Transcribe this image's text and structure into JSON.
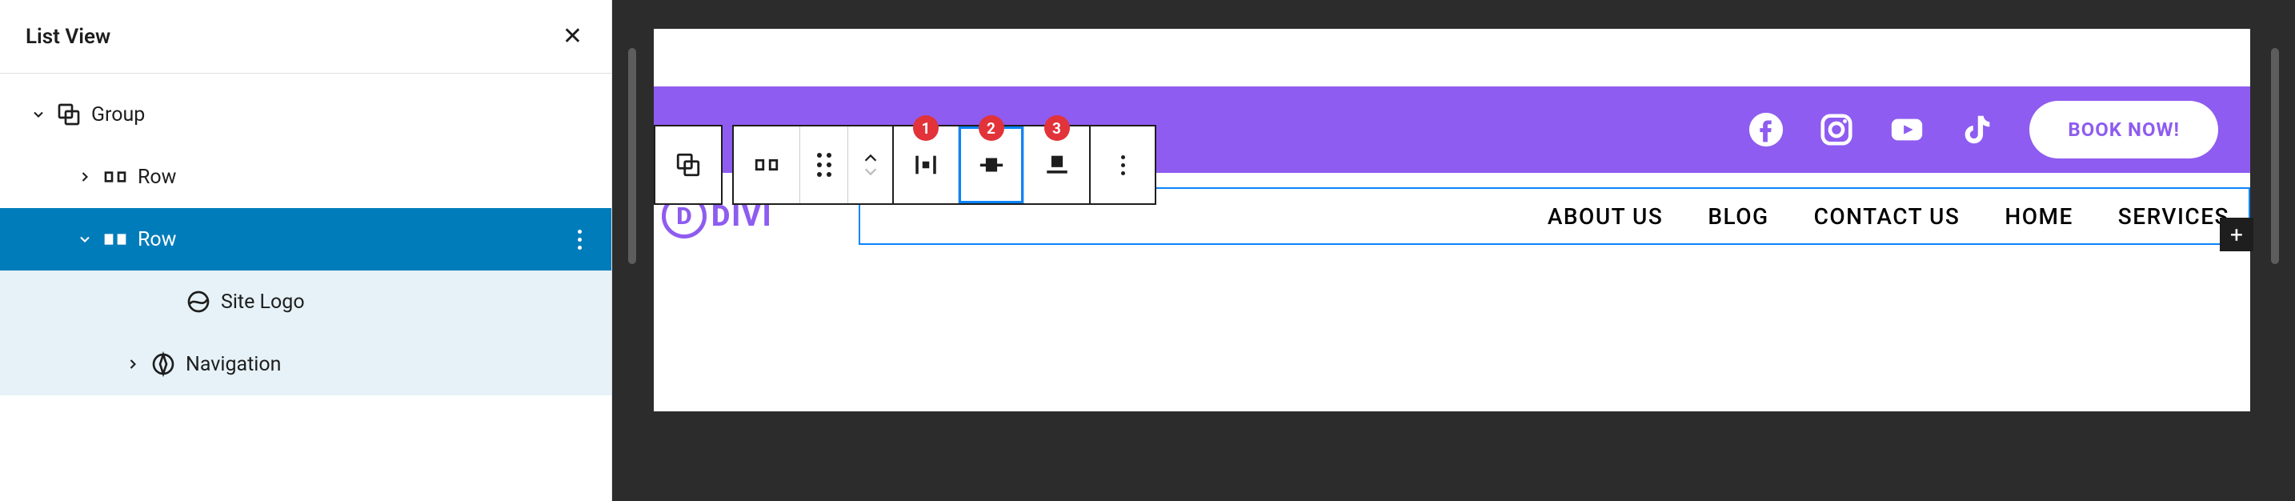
{
  "panel": {
    "title": "List View",
    "tree": {
      "group": {
        "label": "Group"
      },
      "row1": {
        "label": "Row"
      },
      "row2": {
        "label": "Row"
      },
      "siteLogo": {
        "label": "Site Logo"
      },
      "navigation": {
        "label": "Navigation"
      }
    }
  },
  "toolbar": {
    "badges": [
      "1",
      "2",
      "3"
    ]
  },
  "page": {
    "topbar": {
      "cta": "BOOK NOW!"
    },
    "logo": {
      "mark": "D",
      "text": "DIVI"
    },
    "nav": [
      "ABOUT US",
      "BLOG",
      "CONTACT US",
      "HOME",
      "SERVICES"
    ]
  }
}
